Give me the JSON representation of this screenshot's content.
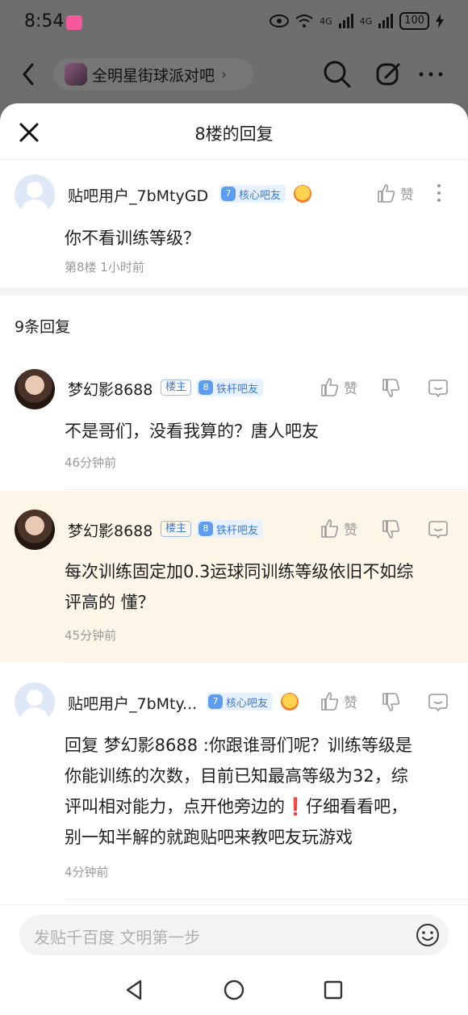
{
  "status": {
    "time": "8:54",
    "battery": "100",
    "signal1": "4G",
    "signal2": "4G"
  },
  "topbar": {
    "forum_name": "全明星街球派对吧",
    "chevron": "›"
  },
  "sheet": {
    "title": "8楼的回复"
  },
  "main_post": {
    "username": "贴吧用户_7bMtyGD",
    "level": "7",
    "badge": "核心吧友",
    "like_label": "赞",
    "text": "你不看训练等级？",
    "meta": "第8楼  1小时前"
  },
  "reply_count": "9条回复",
  "replies": [
    {
      "username": "梦幻影8688",
      "louzhu": "楼主",
      "level": "8",
      "badge": "铁杆吧友",
      "like_label": "赞",
      "text": "不是哥们，没看我算的？唐人吧友",
      "time": "46分钟前"
    },
    {
      "username": "梦幻影8688",
      "louzhu": "楼主",
      "level": "8",
      "badge": "铁杆吧友",
      "like_label": "赞",
      "text_line1": "每次训练固定加0.3运球同训练等级依旧不如综",
      "text_line2": "评高的 懂？",
      "time": "45分钟前"
    },
    {
      "username": "贴吧用户_7bMty...",
      "level": "7",
      "badge": "核心吧友",
      "like_label": "赞",
      "text_line1": "回复 梦幻影8688 :你跟谁哥们呢？训练等级是",
      "text_line2": "你能训练的次数，目前已知最高等级为32，综",
      "text_line3": "评叫相对能力，点开他旁边的❗仔细看看吧，",
      "text_line4": "别一知半解的就跑贴吧来教吧友玩游戏",
      "time": "4分钟前"
    }
  ],
  "input": {
    "placeholder": "发贴千百度 文明第一步"
  },
  "colors": {
    "highlight": "#fdf6e8",
    "badge_blue": "#3a7ad9"
  }
}
